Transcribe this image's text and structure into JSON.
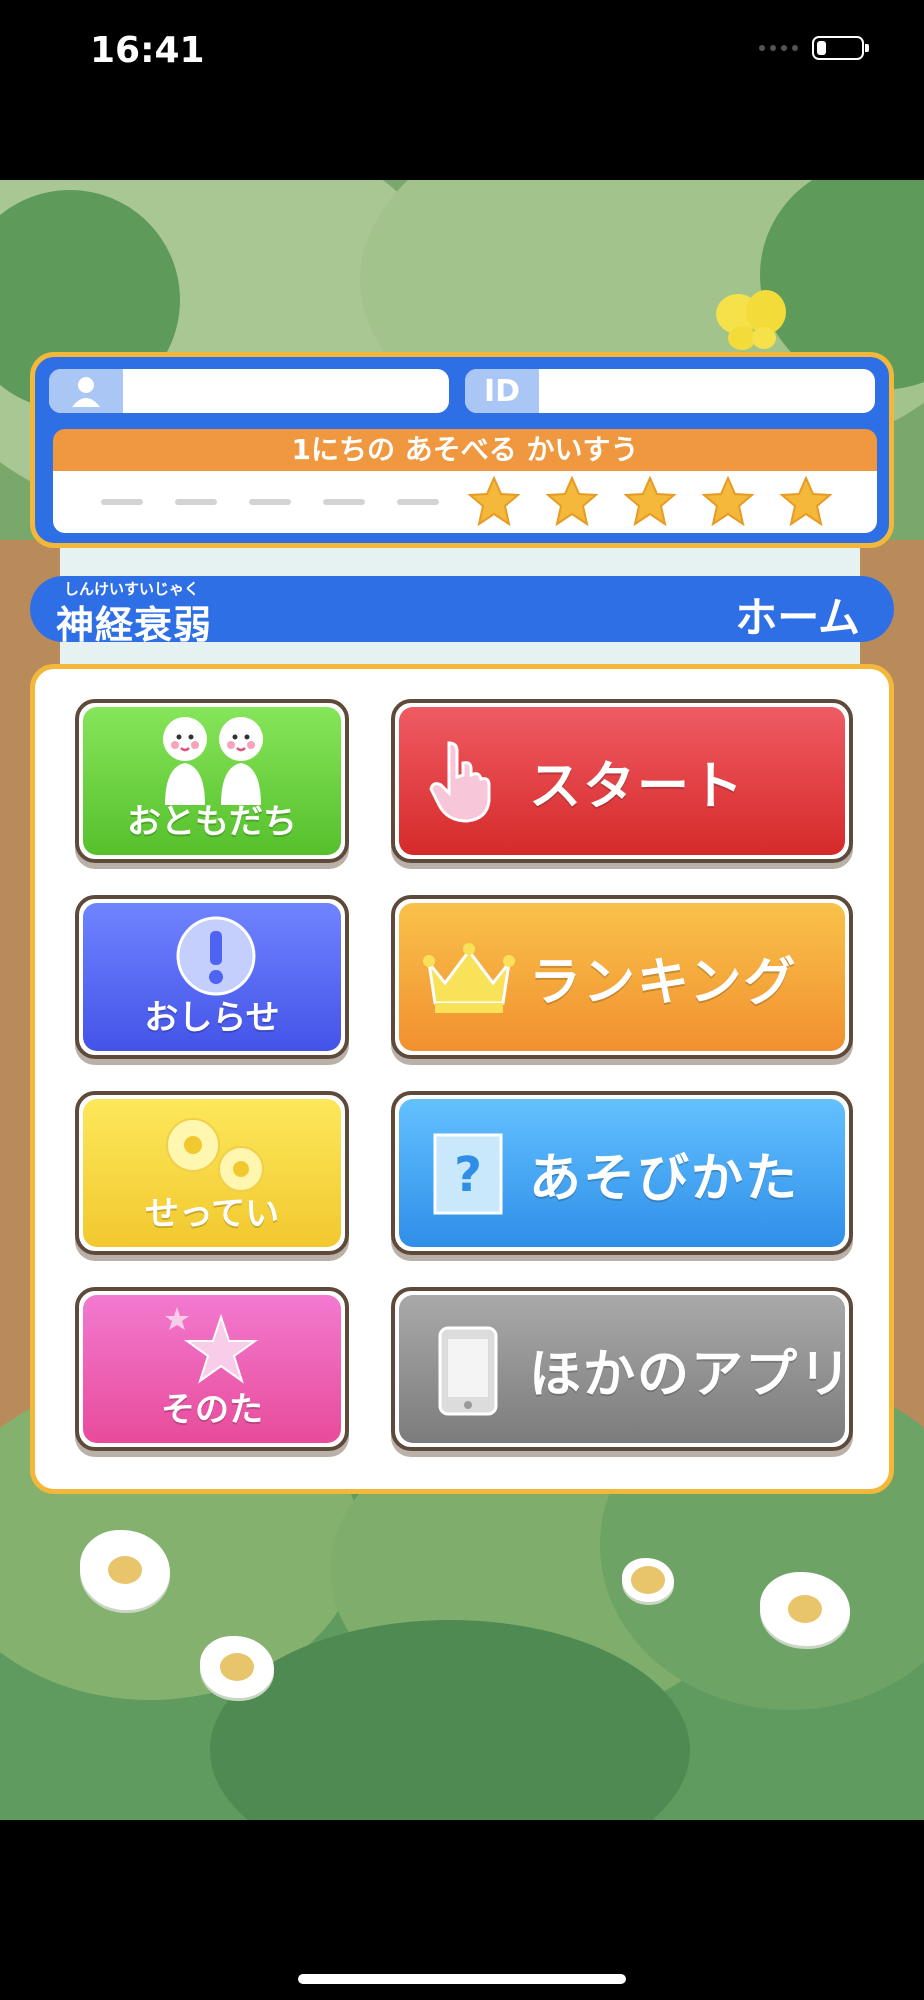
{
  "status_bar": {
    "time": "16:41",
    "battery_level": 0.22
  },
  "profile": {
    "user_tag_icon": "person-icon",
    "id_tag": "ID",
    "user_name": "",
    "user_id": "",
    "plays_title": "1にちの あそべる かいすう",
    "plays_max": 10,
    "plays_remaining": 5
  },
  "header": {
    "game_title_ruby": "しんけいすいじゃく",
    "game_title": "神経衰弱",
    "screen_name": "ホーム"
  },
  "menu": {
    "friends": {
      "label": "おともだち",
      "icon": "friends-icon",
      "color": "#6cd63e"
    },
    "start": {
      "label": "スタート",
      "icon": "pointing-hand-icon",
      "color": "#e23a3c"
    },
    "news": {
      "label": "おしらせ",
      "icon": "exclamation-icon",
      "color": "#4f63f2"
    },
    "ranking": {
      "label": "ランキング",
      "icon": "crown-icon",
      "color": "#f5a63a"
    },
    "settings": {
      "label": "せってい",
      "icon": "gears-icon",
      "color": "#f6d43a"
    },
    "how_to_play": {
      "label": "あそびかた",
      "icon": "question-icon",
      "color": "#3fa6f2"
    },
    "other": {
      "label": "そのた",
      "icon": "stars-icon",
      "color": "#ec5fb4"
    },
    "other_apps": {
      "label": "ほかのアプリ",
      "icon": "smartphone-icon",
      "color": "#8e8e8e"
    }
  }
}
